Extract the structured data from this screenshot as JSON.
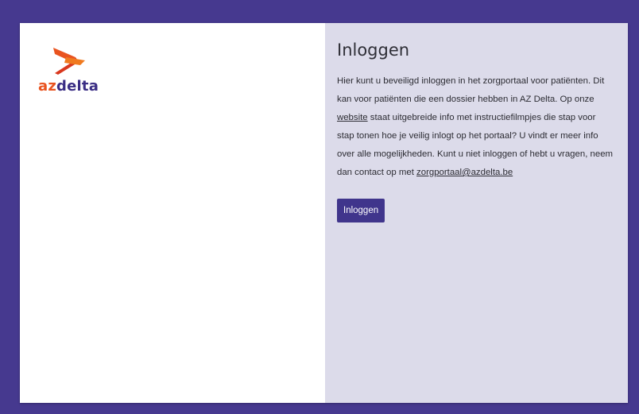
{
  "logo": {
    "text_az": "az",
    "text_delta": "delta",
    "mark_color": "#e9531f",
    "text_color": "#3a2d84"
  },
  "login_card": {
    "title": "Inloggen",
    "paragraph_part1": "Hier kunt u beveiligd inloggen in het zorgportaal voor patiënten. Dit kan voor patiënten die een dossier hebben in AZ Delta. Op onze ",
    "website_link": "website",
    "paragraph_part2": " staat uitgebreide info met instructiefilmpjes die stap voor stap tonen hoe je veilig inlogt op het portaal? U vindt er meer info over alle mogelijkheden. Kunt u niet inloggen of hebt u vragen, neem dan contact op met ",
    "email_link": "zorgportaal@azdelta.be",
    "button_label": "Inloggen"
  },
  "colors": {
    "background": "#46398f",
    "panel_right": "#dcdbea",
    "button": "#40358c"
  }
}
